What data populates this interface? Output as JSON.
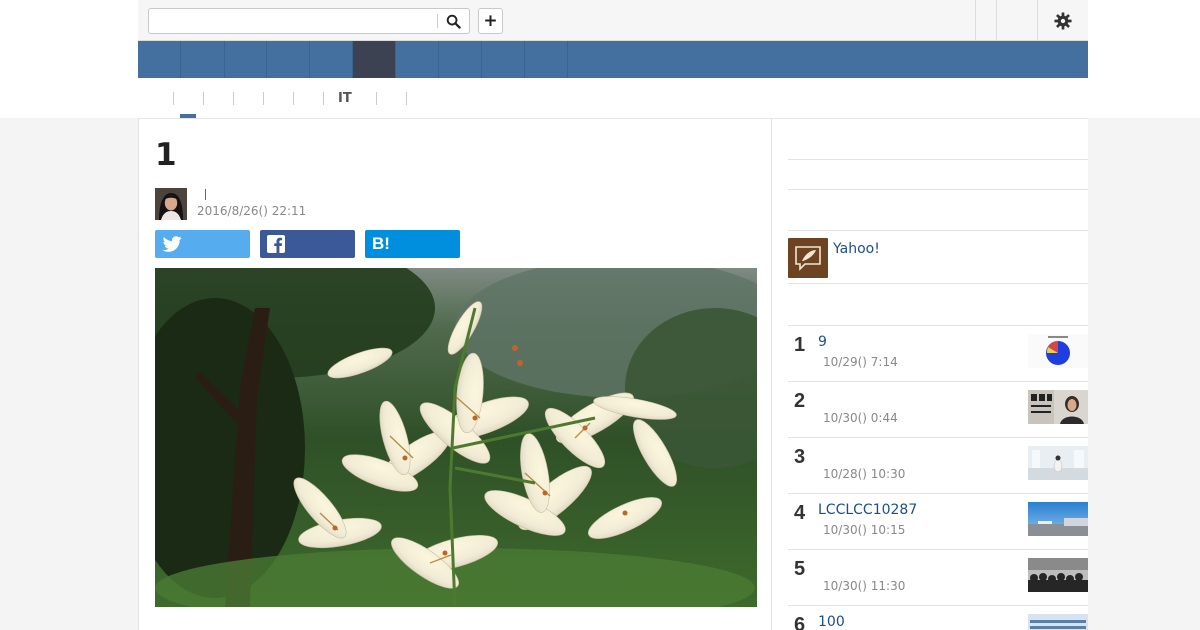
{
  "header": {
    "search": {
      "placeholder": "",
      "value": ""
    },
    "add_label": "+",
    "nav_item_count": 10,
    "active_nav_index": 5
  },
  "subtabs": [
    {
      "label": "",
      "active": true
    },
    {
      "label": ""
    },
    {
      "label": ""
    },
    {
      "label": ""
    },
    {
      "label": ""
    },
    {
      "label": "IT"
    },
    {
      "label": ""
    },
    {
      "label": ""
    }
  ],
  "article": {
    "title": "1",
    "author": "",
    "date": "2016/8/26() 22:11",
    "share": {
      "twitter": "",
      "facebook": "",
      "hatena": "B!"
    }
  },
  "sidebar": {
    "yahoo_label": "Yahoo!",
    "ranking": [
      {
        "rank": "1",
        "title": "9",
        "date": "10/29() 7:14",
        "thumb": "pie-chart"
      },
      {
        "rank": "2",
        "title": "",
        "date": "10/30() 0:44",
        "thumb": "defense-ministry-press"
      },
      {
        "rank": "3",
        "title": "",
        "date": "10/28() 10:30",
        "thumb": "white-interior"
      },
      {
        "rank": "4",
        "title": "LCCLCC10287",
        "date": "10/30() 10:15",
        "thumb": "airport-sky"
      },
      {
        "rank": "5",
        "title": "",
        "date": "10/30() 11:30",
        "thumb": "crowd-bw"
      },
      {
        "rank": "6",
        "title": "100",
        "date": "",
        "thumb": "building"
      }
    ]
  },
  "colors": {
    "nav_blue": "#44709f",
    "nav_active": "#3c4252",
    "link_blue": "#1a4f8f",
    "twitter": "#55acee",
    "facebook": "#3b5998",
    "hatena": "#008fde"
  }
}
